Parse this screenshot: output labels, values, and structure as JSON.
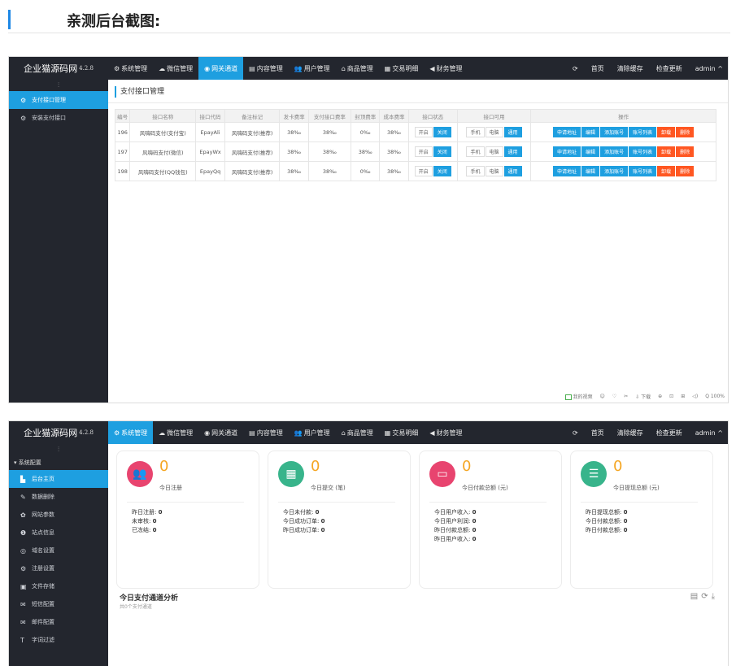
{
  "page": {
    "heading": "亲测后台截图:"
  },
  "app": {
    "brand": "企业猫源码网",
    "version": "4.2.8"
  },
  "topbar": {
    "menu": [
      {
        "icon": "⚙",
        "label": "系统管理"
      },
      {
        "icon": "☁",
        "label": "微信管理"
      },
      {
        "icon": "◉",
        "label": "网关通道"
      },
      {
        "icon": "▤",
        "label": "内容管理"
      },
      {
        "icon": "👥",
        "label": "用户管理"
      },
      {
        "icon": "⌂",
        "label": "商品管理"
      },
      {
        "icon": "▦",
        "label": "交易明细"
      },
      {
        "icon": "◀",
        "label": "财务管理"
      }
    ],
    "refresh_icon": "⟳",
    "home": "首页",
    "clear_cache": "清除缓存",
    "check_update": "检查更新",
    "user": "admin ^"
  },
  "shot1": {
    "sidebar": [
      {
        "icon": "⚙",
        "label": "支付接口管理"
      },
      {
        "icon": "⚙",
        "label": "安装支付接口"
      }
    ],
    "title": "支付接口管理",
    "table": {
      "headers": [
        "编号",
        "接口名称",
        "接口代码",
        "备注标记",
        "发卡费率",
        "支付接口费率",
        "封顶费率",
        "成本费率",
        "接口状态",
        "接口可用",
        "操作"
      ],
      "rows": [
        {
          "id": "196",
          "name": "风嗨码支付(支付宝)",
          "code": "EpayAli",
          "remark": "风嗨码支付(推荐)",
          "r1": "38‰",
          "r2": "38‰",
          "r3": "0‰",
          "r4": "38‰"
        },
        {
          "id": "197",
          "name": "风嗨码支付(微信)",
          "code": "EpayWx",
          "remark": "风嗨码支付(推荐)",
          "r1": "38‰",
          "r2": "38‰",
          "r3": "38‰",
          "r4": "38‰"
        },
        {
          "id": "198",
          "name": "风嗨码支付(QQ钱包)",
          "code": "EpayQq",
          "remark": "风嗨码支付(推荐)",
          "r1": "38‰",
          "r2": "38‰",
          "r3": "0‰",
          "r4": "38‰"
        }
      ],
      "state_buttons": [
        "开启",
        "关闭"
      ],
      "device_buttons": [
        "手机",
        "电脑",
        "通用"
      ],
      "action_buttons": [
        "申请地址",
        "编辑",
        "添加账号",
        "账号列表",
        "卸载",
        "删除"
      ]
    },
    "status_strip": [
      "我的视频",
      "☺",
      "♡",
      "✂",
      "⇩ 下载",
      "⊕",
      "⊡",
      "⊞",
      "◁)",
      "Q 100%"
    ]
  },
  "shot2": {
    "sidebar_group": "▾ 系统配置",
    "sidebar": [
      {
        "icon": "▙",
        "label": "后台主页"
      },
      {
        "icon": "✎",
        "label": "数据删除"
      },
      {
        "icon": "✿",
        "label": "网站参数"
      },
      {
        "icon": "❶",
        "label": "站点信息"
      },
      {
        "icon": "◎",
        "label": "域名设置"
      },
      {
        "icon": "⚙",
        "label": "注册设置"
      },
      {
        "icon": "▣",
        "label": "文件存储"
      },
      {
        "icon": "✉",
        "label": "短信配置"
      },
      {
        "icon": "✉",
        "label": "邮件配置"
      },
      {
        "icon": "T",
        "label": "字词过滤"
      }
    ],
    "cards": [
      {
        "icon": "👥",
        "color": "#e8446f",
        "value": "0",
        "label": "今日注册",
        "lines": [
          [
            "昨日注册: ",
            "0"
          ],
          [
            "未审核: ",
            "0"
          ],
          [
            "已冻结: ",
            "0"
          ]
        ]
      },
      {
        "icon": "▦",
        "color": "#38b48b",
        "value": "0",
        "label": "今日提交 (笔)",
        "lines": [
          [
            "今日未付款: ",
            "0"
          ],
          [
            "今日成功订单: ",
            "0"
          ],
          [
            "昨日成功订单: ",
            "0"
          ]
        ]
      },
      {
        "icon": "▭",
        "color": "#e8446f",
        "value": "0",
        "label": "今日付款总额 (元)",
        "lines": [
          [
            "今日用户收入: ",
            "0"
          ],
          [
            "今日用户利润: ",
            "0"
          ],
          [
            "昨日付款总额: ",
            "0"
          ],
          [
            "昨日用户收入: ",
            "0"
          ]
        ]
      },
      {
        "icon": "☰",
        "color": "#38b48b",
        "value": "0",
        "label": "今日提现总额 (元)",
        "lines": [
          [
            "昨日提现总额: ",
            "0"
          ],
          [
            "今日付款总额: ",
            "0"
          ],
          [
            "昨日付款总额: ",
            "0"
          ]
        ]
      }
    ],
    "analysis": {
      "title": "今日支付通道分析",
      "subtitle": "共0个支付通道",
      "tools": "▤⟳⤓"
    }
  }
}
